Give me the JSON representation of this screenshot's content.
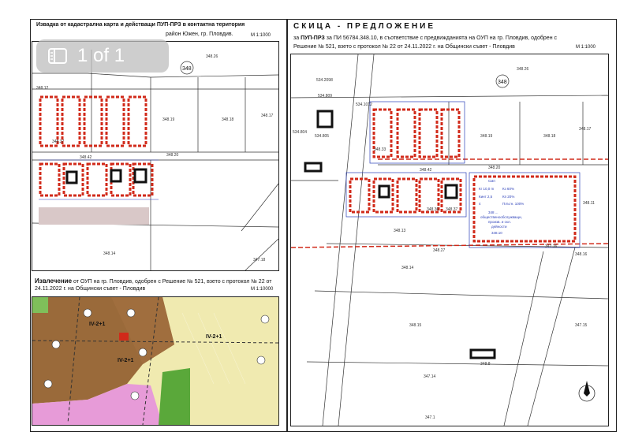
{
  "left_top": {
    "title": "Извадка от кадастрална карта и действащи ПУП-ПРЗ в контактна територия",
    "subtitle": "район Южен, гр. Пловдив.",
    "scale": "М 1:1000",
    "lot_labels": [
      "348.26",
      "348.19",
      "348.18",
      "348.17",
      "348.20",
      "348.14",
      "347.18",
      "348.37",
      "348.42",
      "348.12"
    ]
  },
  "left_bottom": {
    "title_bold": "Извлечение",
    "title_rest": "от ОУП на гр. Пловдив,  одобрен с Решение № 521, взето с протокол № 22  от",
    "line2": "24.11.2022 г. на Общински съвет - Пловдив",
    "scale": "М 1:10000",
    "zone_labels": [
      "IV-2+1",
      "IV-2+1",
      "IV-2+1"
    ]
  },
  "right": {
    "title": "СКИЦА - ПРЕДЛОЖЕНИЕ",
    "line1_prefix": "за",
    "line1_bold": "ПУП-ПРЗ",
    "line1_rest": "за ПИ 56784.348.10, в съответствие с предвижданията на ОУП на гр. Пловдив, одобрен с",
    "line2": "Решение № 521, взето с протокол № 22  от 24.11.2022 г. на Общински съвет - Пловдив",
    "scale": "М 1:1000",
    "lot_labels": [
      "348",
      "348.26",
      "534.2098",
      "534.809",
      "534.1012",
      "534.805",
      "348.19",
      "348.18",
      "348.17",
      "348.20",
      "348.42",
      "348.33",
      "348.36",
      "348.37",
      "348.11",
      "348.13",
      "348.27",
      "348.14",
      "348.15",
      "348.16",
      "347.15",
      "347.16",
      "347.14",
      "347.1",
      "348.8",
      "534.804"
    ],
    "table": [
      "Смп",
      "Кг 10,0 m",
      "Кз 60%",
      "Кинт 2,5",
      "Кп 20%",
      "4",
      "Плътн. 100%"
    ],
    "table_note": [
      "348 ...",
      "общественообслужващи,",
      "произв. и скл.",
      "дейности",
      "348.10"
    ]
  },
  "viewer": {
    "page_indicator": "1 of 1"
  },
  "colors": {
    "red": "#d12a1a",
    "blue": "#2b3fb8",
    "zone_brown": "#9a6a3a",
    "zone_yellow": "#f0eab0",
    "zone_pink": "#e79bd8",
    "zone_green": "#5aa83a"
  }
}
